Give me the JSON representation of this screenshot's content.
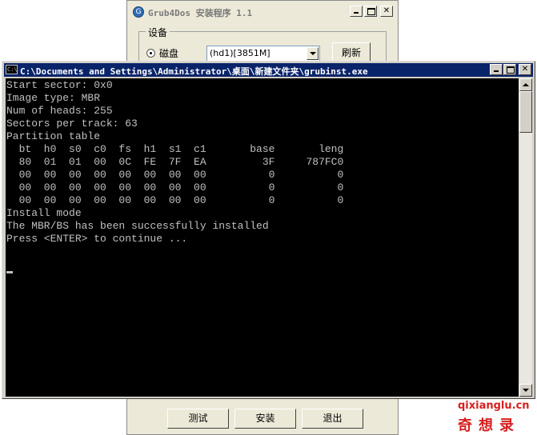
{
  "installer": {
    "title": "Grub4Dos 安装程序 1.1",
    "group_label": "设备",
    "radio_label": "磁盘",
    "device_value": "(hd1)[3851M]",
    "refresh_label": "刷新",
    "test_label": "测试",
    "install_label": "安装",
    "exit_label": "退出"
  },
  "console": {
    "title": "C:\\Documents and Settings\\Administrator\\桌面\\新建文件夹\\grubinst.exe",
    "output": "Start sector: 0x0\nImage type: MBR\nNum of heads: 255\nSectors per track: 63\nPartition table\n  bt  h0  s0  c0  fs  h1  s1  c1       base       leng\n  80  01  01  00  0C  FE  7F  EA         3F     787FC0\n  00  00  00  00  00  00  00  00          0          0\n  00  00  00  00  00  00  00  00          0          0\n  00  00  00  00  00  00  00  00          0          0\nInstall mode\nThe MBR/BS has been successfully installed\nPress <ENTER> to continue ..."
  },
  "watermark": {
    "url": "qixianglu.cn",
    "name": "奇想录"
  },
  "colors": {
    "console_bg": "#000000",
    "console_text": "#c0c0c0",
    "title_active": "#0a246a",
    "window_face": "#ece9d8",
    "watermark": "#d62020"
  }
}
